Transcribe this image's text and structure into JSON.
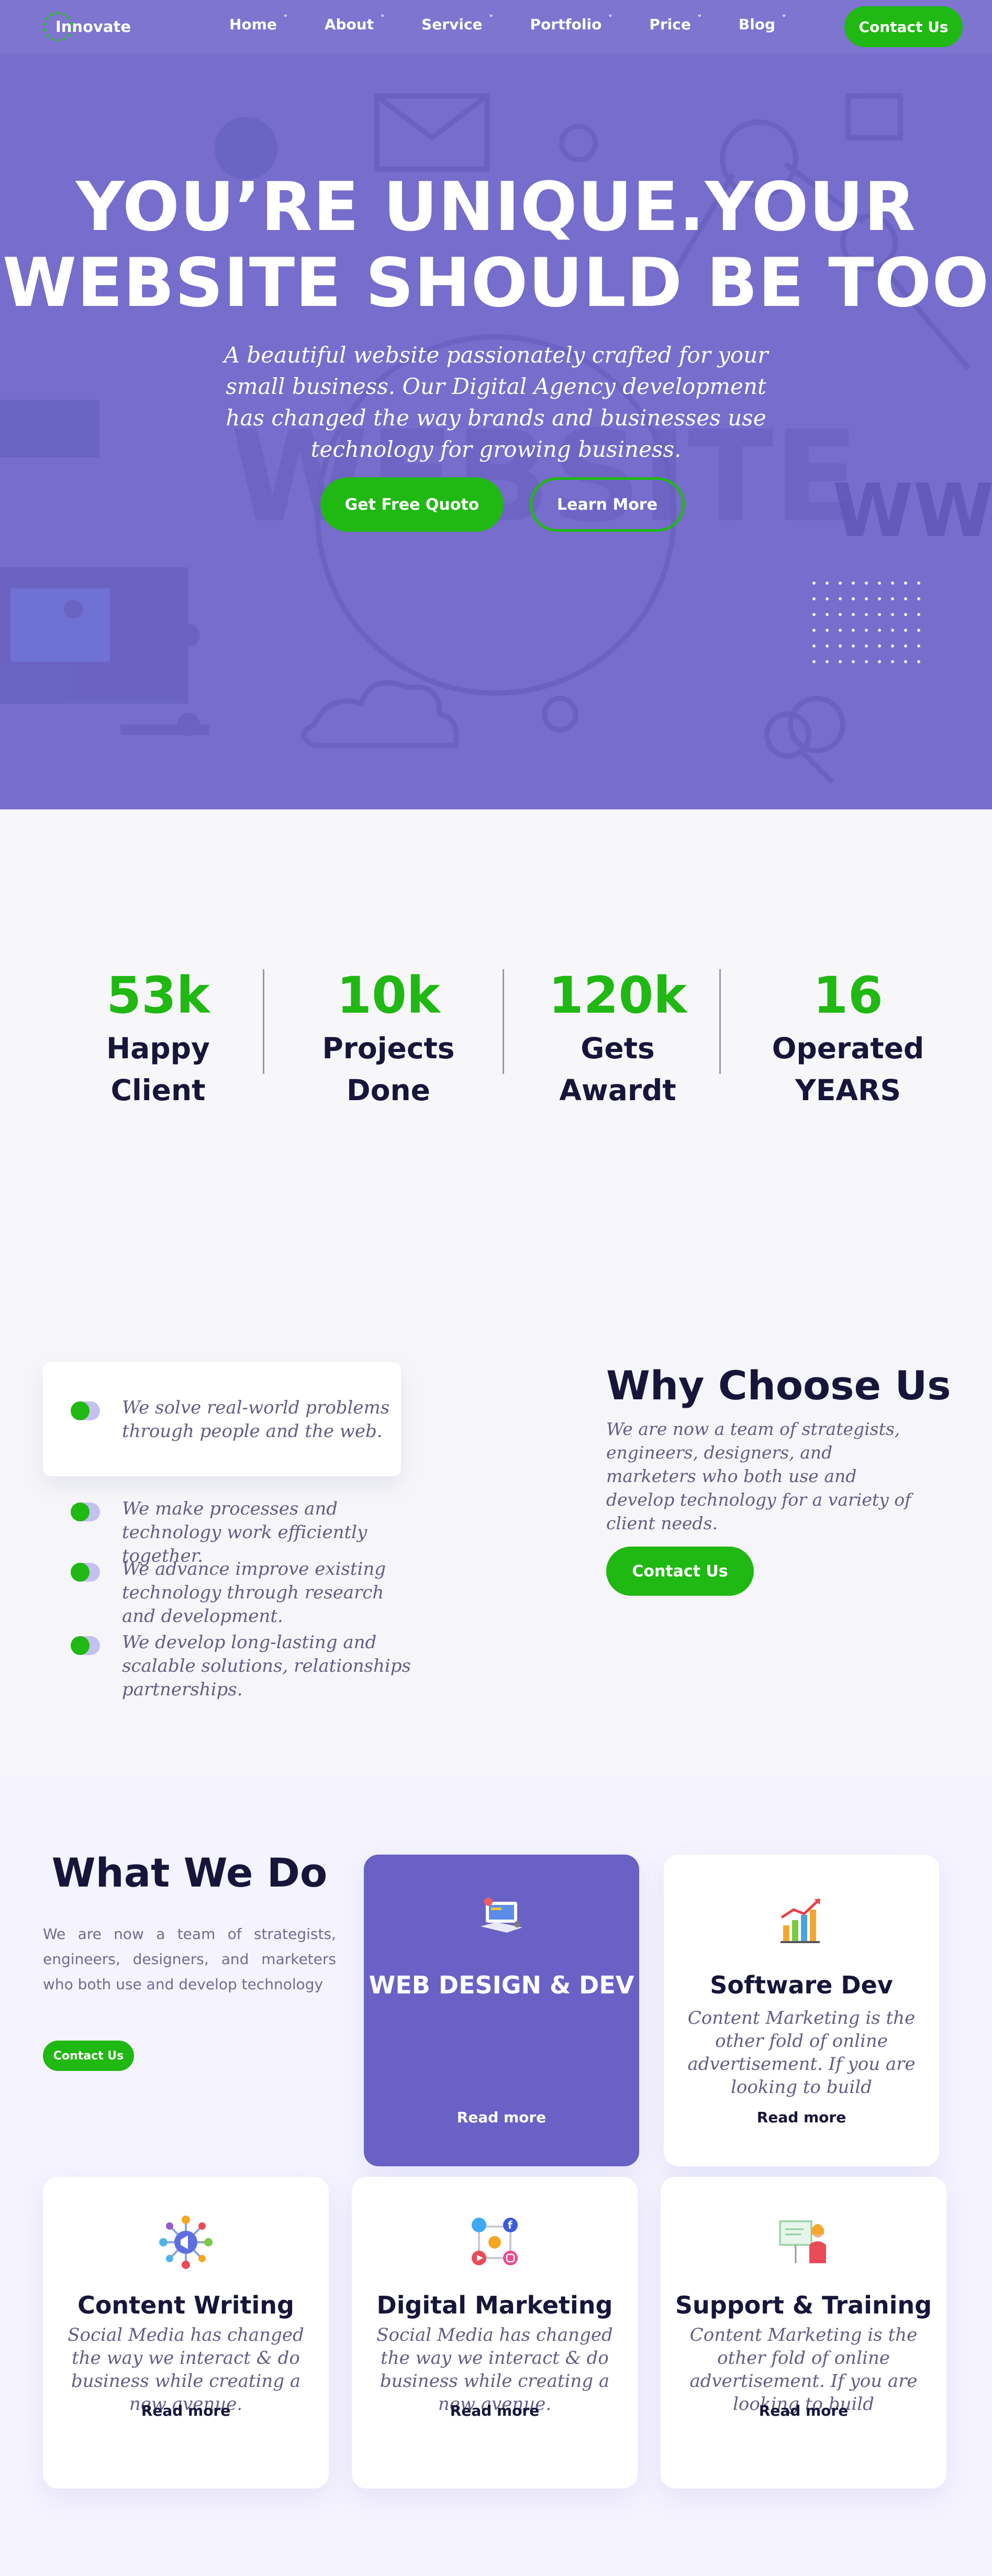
{
  "nav": {
    "logo": "Innovate",
    "items": [
      {
        "label": "Home"
      },
      {
        "label": "About"
      },
      {
        "label": "Service"
      },
      {
        "label": "Portfolio"
      },
      {
        "label": "Price"
      },
      {
        "label": "Blog"
      }
    ],
    "contact_label": "Contact Us"
  },
  "hero": {
    "title_line1": "YOU’RE UNIQUE.YOUR",
    "title_line2": "WEBSITE SHOULD BE TOO",
    "subtitle": "A beautiful website passionately crafted for your small business. Our Digital Agency development has changed the way brands and businesses use technology for growing business.",
    "quote_label": "Get Free Quoto",
    "learn_label": "Learn More",
    "bg_word": "WEBSITE",
    "bg_www": "WWW"
  },
  "stats": [
    {
      "value": "53k",
      "label": "Happy Client"
    },
    {
      "value": "10k",
      "label": "Projects Done"
    },
    {
      "value": "120k",
      "label": "Gets Awardt"
    },
    {
      "value": "16",
      "label": "Operated YEARS"
    }
  ],
  "why": {
    "features": [
      "We solve real-world problems through people and the web.",
      "We make processes and technology work efficiently together.",
      "We advance improve existing technology through research and development.",
      "We develop long-lasting and scalable solutions, relationships partnerships."
    ],
    "title": "Why Choose Us",
    "text": "We are now a team of strategists, engineers, designers, and marketers who both use and develop technology for a variety of client needs.",
    "button_label": "Contact Us"
  },
  "what": {
    "title": "What We Do",
    "text": "We are now a team of strategists, engineers, designers, and marketers who both use and develop technology",
    "button_label": "Contact Us",
    "cards": [
      {
        "title": "WEB DESIGN & DEV",
        "desc": "",
        "more": "Read more",
        "icon": "web-design-icon"
      },
      {
        "title": "Software Dev",
        "desc": "Content Marketing is the other fold of online advertisement. If you are looking to build",
        "more": "Read more",
        "icon": "chart-icon"
      },
      {
        "title": "Content Writing",
        "desc": "Social Media has changed the way we interact & do business while creating a new avenue.",
        "more": "Read more",
        "icon": "megaphone-icon"
      },
      {
        "title": "Digital Marketing",
        "desc": "Social Media has changed the way we interact & do business while creating a new avenue.",
        "more": "Read more",
        "icon": "social-media-icon"
      },
      {
        "title": "Support & Training",
        "desc": "Content Marketing is the other fold of online advertisement. If you are looking to build",
        "more": "Read more",
        "icon": "presentation-icon"
      }
    ]
  },
  "colors": {
    "accent": "#20b812",
    "hero": "#766dcc",
    "primary_card": "#6a61c6",
    "dark": "#171539"
  }
}
